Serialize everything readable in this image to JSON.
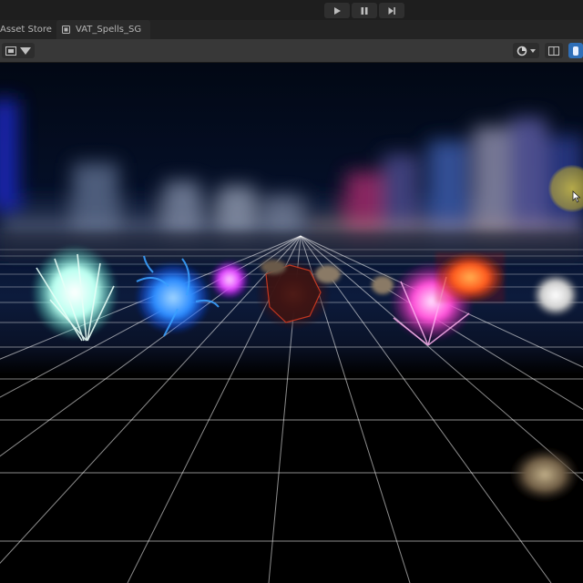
{
  "playbar": {
    "buttons": [
      {
        "name": "play-icon"
      },
      {
        "name": "pause-icon"
      },
      {
        "name": "step-icon"
      }
    ]
  },
  "tabs": {
    "store": "Asset Store",
    "scene": "VAT_Spells_SG"
  },
  "toolbar": {
    "left_icon": "draw-mode-icon",
    "right_icons": [
      "gizmos-icon",
      "grid-icon",
      "camera-icon"
    ],
    "accent": "#2f6fb8"
  },
  "scene": {
    "background_top": "#020814",
    "grid_color": "#ffffff",
    "effects": [
      {
        "name": "ice-burst",
        "color": "#b9fff0"
      },
      {
        "name": "water-splash",
        "color": "#2b8cff"
      },
      {
        "name": "arcane-orb",
        "color": "#e040ff"
      },
      {
        "name": "lava-rock",
        "color": "#b82814"
      },
      {
        "name": "crystal-cluster",
        "color": "#ff4fd8"
      },
      {
        "name": "fire-block",
        "color": "#ff5a1e"
      },
      {
        "name": "frost-ball",
        "color": "#e6e6e6"
      },
      {
        "name": "rock-debris",
        "color": "#8a7a60"
      }
    ]
  }
}
